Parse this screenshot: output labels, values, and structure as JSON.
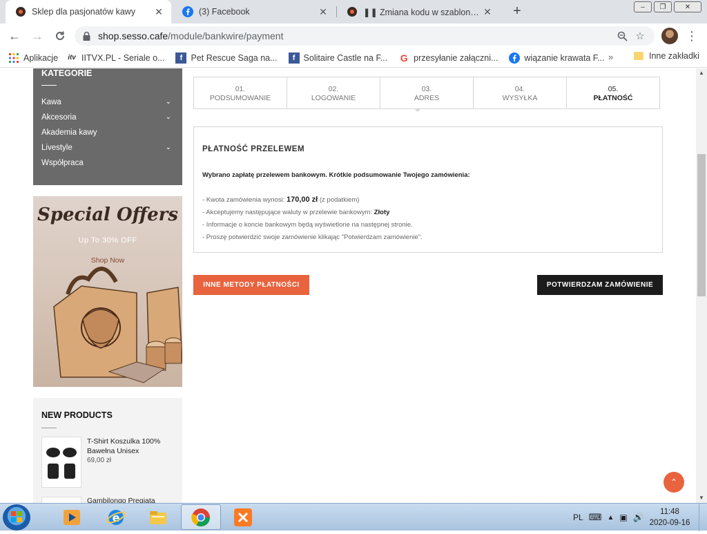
{
  "browser": {
    "tabs": [
      {
        "title": "Sklep dla pasjonatów kawy",
        "close": "✕"
      },
      {
        "title": "(3) Facebook",
        "close": "✕"
      },
      {
        "title": "Zmiana kodu w szablonie w za",
        "close": "✕"
      }
    ],
    "new_tab": "+",
    "url_host": "shop.sesso.cafe",
    "url_path": "/module/bankwire/payment",
    "bookmarks": [
      {
        "label": "Aplikacje",
        "icon": "apps-grid-icon"
      },
      {
        "label": "IITVX.PL - Seriale o...",
        "icon": "tv-icon"
      },
      {
        "label": "Pet Rescue Saga na...",
        "icon": "facebook-icon"
      },
      {
        "label": "Solitaire Castle na F...",
        "icon": "facebook-icon"
      },
      {
        "label": "przesyłanie załączni...",
        "icon": "google-icon"
      },
      {
        "label": "wiązanie krawata  F...",
        "icon": "facebook-icon"
      }
    ],
    "bookmarks_more": "»",
    "other_bookmarks": "Inne zakładki"
  },
  "sidebar": {
    "categories_title": "KATEGORIE",
    "categories": [
      {
        "label": "Kawa",
        "has_children": true
      },
      {
        "label": "Akcesoria",
        "has_children": true
      },
      {
        "label": "Akademia kawy",
        "has_children": false
      },
      {
        "label": "Livestyle",
        "has_children": true
      },
      {
        "label": "Współpraca",
        "has_children": false
      }
    ],
    "promo": {
      "title": "Special Offers",
      "subtitle": "Up To 30% OFF",
      "cta": "Shop Now"
    },
    "new_products": {
      "title": "NEW PRODUCTS",
      "items": [
        {
          "name": "T-Shirt Koszulka 100% Bawełna Unisex",
          "price": "69,00 zł"
        },
        {
          "name": "Gambilongo Pregiata",
          "price": ""
        }
      ]
    }
  },
  "checkout": {
    "steps": [
      {
        "num": "01.",
        "label": "PODSUMOWANIE",
        "active": false
      },
      {
        "num": "02.",
        "label": "LOGOWANIE",
        "active": false
      },
      {
        "num": "03.",
        "label": "ADRES",
        "active": false
      },
      {
        "num": "04.",
        "label": "WYSYŁKA",
        "active": false
      },
      {
        "num": "05.",
        "label": "PŁATNOŚĆ",
        "active": true
      }
    ],
    "panel_title": "PŁATNOŚĆ PRZELEWEM",
    "intro": "Wybrano zapłatę przelewem bankowym. Krótkie podsumowanie Twojego zamówienia:",
    "line1_prefix": "- Kwota zamówienia wynosi:",
    "amount": "170,00 zł",
    "line1_suffix": "(z podatkiem)",
    "line2_prefix": "- Akceptujemy następujące waluty w przelewie bankowym:",
    "currency": "Złoty",
    "line3": "- Informacje o koncie bankowym będą wyświetlone na następnej stronie.",
    "line4": "- Proszę potwierdzić swoje zamówienie klikając \"Potwierdzam zamówienie\".",
    "btn_other": "INNE METODY PŁATNOŚCI",
    "btn_confirm": "POTWIERDZAM ZAMÓWIENIE"
  },
  "taskbar": {
    "language": "PL",
    "time": "11:48",
    "date": "2020-09-16"
  },
  "colors": {
    "accent": "#e8633e",
    "dark_button": "#1b1b1b",
    "sidebar_bg": "#6a6a6a"
  }
}
